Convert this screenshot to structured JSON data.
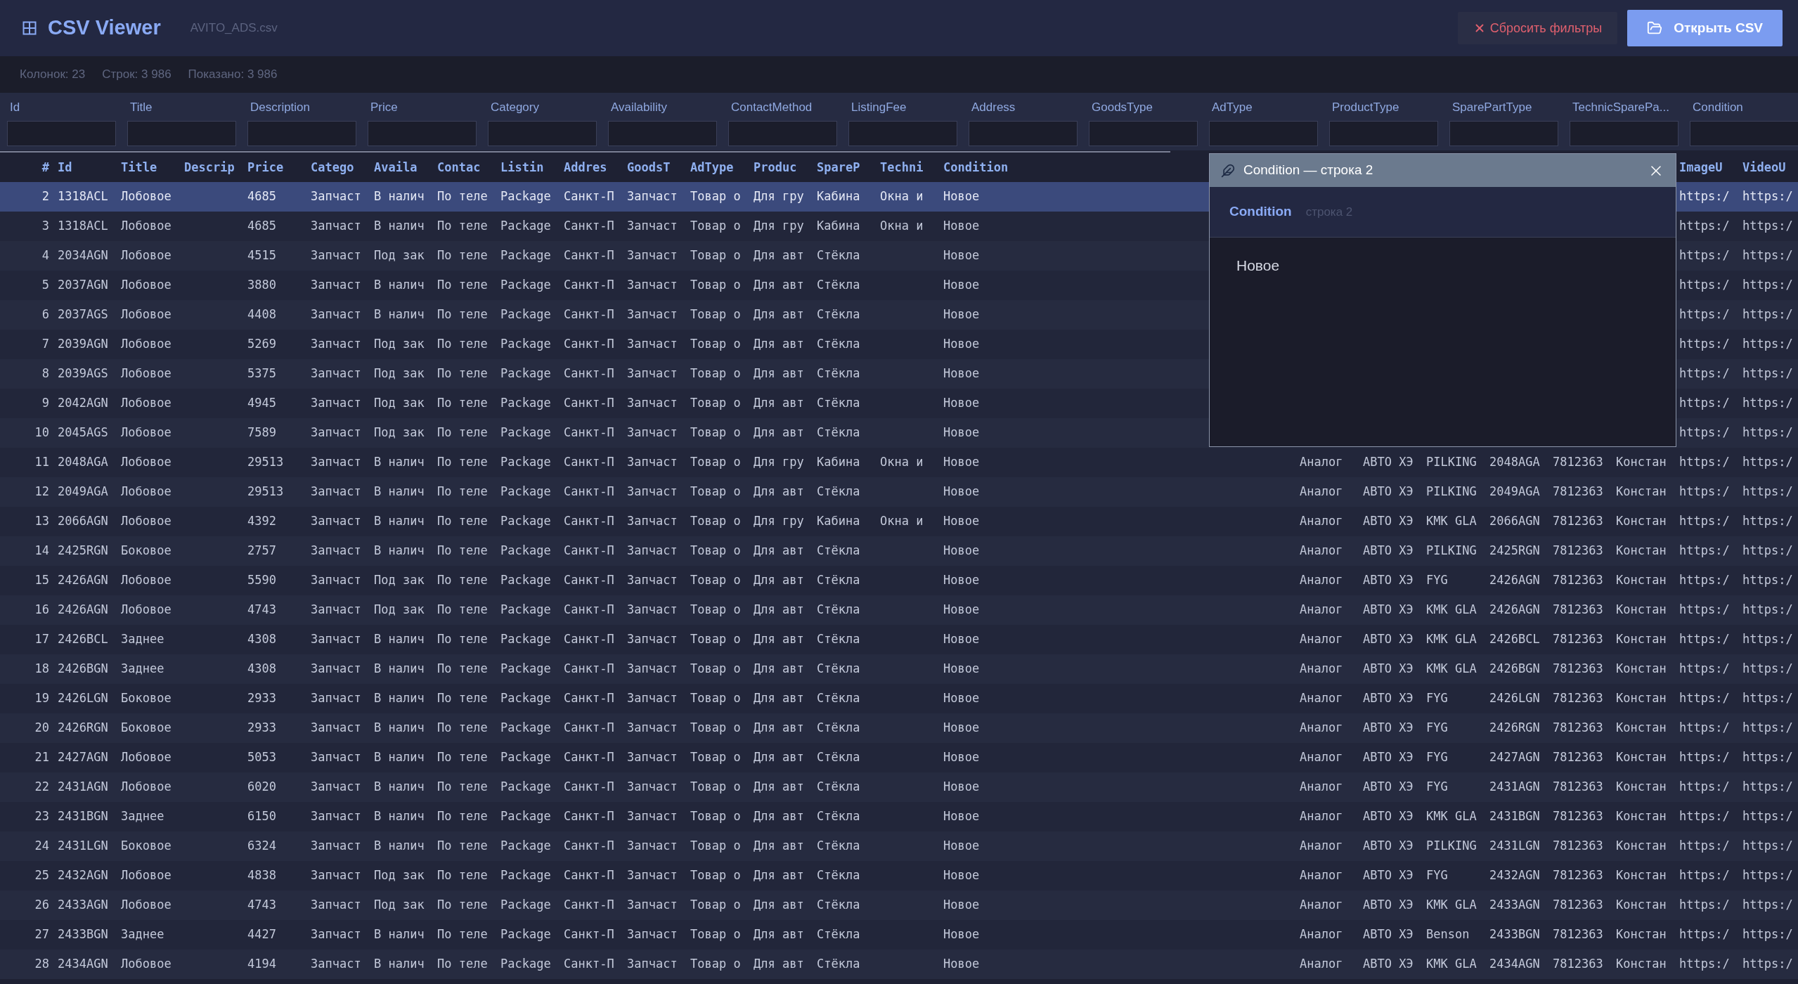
{
  "app": {
    "title": "CSV Viewer",
    "file_name": "AVITO_ADS.csv"
  },
  "buttons": {
    "reset": "Сбросить фильтры",
    "open": "Открыть CSV"
  },
  "stats": [
    "Колонок: 23",
    "Строк: 3 986",
    "Показано: 3 986"
  ],
  "filters": [
    {
      "label": "Id"
    },
    {
      "label": "Title"
    },
    {
      "label": "Description"
    },
    {
      "label": "Price"
    },
    {
      "label": "Category"
    },
    {
      "label": "Availability"
    },
    {
      "label": "ContactMethod"
    },
    {
      "label": "ListingFee"
    },
    {
      "label": "Address"
    },
    {
      "label": "GoodsType"
    },
    {
      "label": "AdType"
    },
    {
      "label": "ProductType"
    },
    {
      "label": "SparePartType"
    },
    {
      "label": "TechnicSparePa..."
    },
    {
      "label": "Condition"
    }
  ],
  "table": {
    "header": {
      "n": "#",
      "id": "Id",
      "title": "Title",
      "description": "Descrip",
      "price": "Price",
      "category": "Catego",
      "availability": "Availa",
      "contact": "Contac",
      "listing": "Listin",
      "address": "Addres",
      "goods_type": "GoodsT",
      "ad_type": "AdType",
      "product": "Produc",
      "spare_part": "SpareP",
      "technic": "Techni",
      "condition": "Condition",
      "image_url": "ImageU",
      "video_url": "VideoU"
    },
    "rows": [
      {
        "selected": true,
        "n": "2",
        "id": "1318ACL",
        "title": "Лобовое",
        "price": "4685",
        "category": "Запчаст",
        "availability": "В налич",
        "contact": "По теле",
        "listing": "Package",
        "address": "Санкт-П",
        "goods_type": "Запчаст",
        "ad_type": "Товар о",
        "product": "Для гру",
        "spare_part": "Кабина",
        "technic": "Окна и",
        "condition": "Новое",
        "image_url": "https:/",
        "video_url": "https:/"
      },
      {
        "selected": false,
        "n": "3",
        "id": "1318ACL",
        "title": "Лобовое",
        "price": "4685",
        "category": "Запчаст",
        "availability": "В налич",
        "contact": "По теле",
        "listing": "Package",
        "address": "Санкт-П",
        "goods_type": "Запчаст",
        "ad_type": "Товар о",
        "product": "Для гру",
        "spare_part": "Кабина",
        "technic": "Окна и",
        "condition": "Новое",
        "image_url": "https:/",
        "video_url": "https:/"
      },
      {
        "selected": false,
        "n": "4",
        "id": "2034AGN",
        "title": "Лобовое",
        "price": "4515",
        "category": "Запчаст",
        "availability": "Под зак",
        "contact": "По теле",
        "listing": "Package",
        "address": "Санкт-П",
        "goods_type": "Запчаст",
        "ad_type": "Товар о",
        "product": "Для авт",
        "spare_part": "Стёкла",
        "condition": "Новое",
        "image_url": "https:/",
        "video_url": "https:/"
      },
      {
        "selected": false,
        "n": "5",
        "id": "2037AGN",
        "title": "Лобовое",
        "price": "3880",
        "category": "Запчаст",
        "availability": "В налич",
        "contact": "По теле",
        "listing": "Package",
        "address": "Санкт-П",
        "goods_type": "Запчаст",
        "ad_type": "Товар о",
        "product": "Для авт",
        "spare_part": "Стёкла",
        "condition": "Новое",
        "image_url": "https:/",
        "video_url": "https:/"
      },
      {
        "selected": false,
        "n": "6",
        "id": "2037AGS",
        "title": "Лобовое",
        "price": "4408",
        "category": "Запчаст",
        "availability": "В налич",
        "contact": "По теле",
        "listing": "Package",
        "address": "Санкт-П",
        "goods_type": "Запчаст",
        "ad_type": "Товар о",
        "product": "Для авт",
        "spare_part": "Стёкла",
        "condition": "Новое",
        "image_url": "https:/",
        "video_url": "https:/"
      },
      {
        "selected": false,
        "n": "7",
        "id": "2039AGN",
        "title": "Лобовое",
        "price": "5269",
        "category": "Запчаст",
        "availability": "Под зак",
        "contact": "По теле",
        "listing": "Package",
        "address": "Санкт-П",
        "goods_type": "Запчаст",
        "ad_type": "Товар о",
        "product": "Для авт",
        "spare_part": "Стёкла",
        "condition": "Новое",
        "image_url": "https:/",
        "video_url": "https:/"
      },
      {
        "selected": false,
        "n": "8",
        "id": "2039AGS",
        "title": "Лобовое",
        "price": "5375",
        "category": "Запчаст",
        "availability": "Под зак",
        "contact": "По теле",
        "listing": "Package",
        "address": "Санкт-П",
        "goods_type": "Запчаст",
        "ad_type": "Товар о",
        "product": "Для авт",
        "spare_part": "Стёкла",
        "condition": "Новое",
        "image_url": "https:/",
        "video_url": "https:/"
      },
      {
        "selected": false,
        "n": "9",
        "id": "2042AGN",
        "title": "Лобовое",
        "price": "4945",
        "category": "Запчаст",
        "availability": "Под зак",
        "contact": "По теле",
        "listing": "Package",
        "address": "Санкт-П",
        "goods_type": "Запчаст",
        "ad_type": "Товар о",
        "product": "Для авт",
        "spare_part": "Стёкла",
        "condition": "Новое",
        "image_url": "https:/",
        "video_url": "https:/"
      },
      {
        "selected": false,
        "n": "10",
        "id": "2045AGS",
        "title": "Лобовое",
        "price": "7589",
        "category": "Запчаст",
        "availability": "Под зак",
        "contact": "По теле",
        "listing": "Package",
        "address": "Санкт-П",
        "goods_type": "Запчаст",
        "ad_type": "Товар о",
        "product": "Для авт",
        "spare_part": "Стёкла",
        "condition": "Новое",
        "image_url": "https:/",
        "video_url": "https:/"
      },
      {
        "selected": false,
        "n": "11",
        "id": "2048AGA",
        "title": "Лобовое",
        "price": "29513",
        "category": "Запчаст",
        "availability": "В налич",
        "contact": "По теле",
        "listing": "Package",
        "address": "Санкт-П",
        "goods_type": "Запчаст",
        "ad_type": "Товар о",
        "product": "Для гру",
        "spare_part": "Кабина",
        "technic": "Окна и",
        "condition": "Новое",
        "column_17": "Аналог",
        "column_18": "АВТО ХЭ",
        "column_19": "PILKING",
        "column_20": "2048AGA",
        "column_21": "7812363",
        "column_22": "Констан",
        "image_url": "https:/",
        "video_url": "https:/"
      },
      {
        "selected": false,
        "n": "12",
        "id": "2049AGA",
        "title": "Лобовое",
        "price": "29513",
        "category": "Запчаст",
        "availability": "В налич",
        "contact": "По теле",
        "listing": "Package",
        "address": "Санкт-П",
        "goods_type": "Запчаст",
        "ad_type": "Товар о",
        "product": "Для авт",
        "spare_part": "Стёкла",
        "condition": "Новое",
        "column_17": "Аналог",
        "column_18": "АВТО ХЭ",
        "column_19": "PILKING",
        "column_20": "2049AGA",
        "column_21": "7812363",
        "column_22": "Констан",
        "image_url": "https:/",
        "video_url": "https:/"
      },
      {
        "selected": false,
        "n": "13",
        "id": "2066AGN",
        "title": "Лобовое",
        "price": "4392",
        "category": "Запчаст",
        "availability": "В налич",
        "contact": "По теле",
        "listing": "Package",
        "address": "Санкт-П",
        "goods_type": "Запчаст",
        "ad_type": "Товар о",
        "product": "Для гру",
        "spare_part": "Кабина",
        "technic": "Окна и",
        "condition": "Новое",
        "column_17": "Аналог",
        "column_18": "АВТО ХЭ",
        "column_19": "KMK GLA",
        "column_20": "2066AGN",
        "column_21": "7812363",
        "column_22": "Констан",
        "image_url": "https:/",
        "video_url": "https:/"
      },
      {
        "selected": false,
        "n": "14",
        "id": "2425RGN",
        "title": "Боковое",
        "price": "2757",
        "category": "Запчаст",
        "availability": "В налич",
        "contact": "По теле",
        "listing": "Package",
        "address": "Санкт-П",
        "goods_type": "Запчаст",
        "ad_type": "Товар о",
        "product": "Для авт",
        "spare_part": "Стёкла",
        "condition": "Новое",
        "column_17": "Аналог",
        "column_18": "АВТО ХЭ",
        "column_19": "PILKING",
        "column_20": "2425RGN",
        "column_21": "7812363",
        "column_22": "Констан",
        "image_url": "https:/",
        "video_url": "https:/"
      },
      {
        "selected": false,
        "n": "15",
        "id": "2426AGN",
        "title": "Лобовое",
        "price": "5590",
        "category": "Запчаст",
        "availability": "Под зак",
        "contact": "По теле",
        "listing": "Package",
        "address": "Санкт-П",
        "goods_type": "Запчаст",
        "ad_type": "Товар о",
        "product": "Для авт",
        "spare_part": "Стёкла",
        "condition": "Новое",
        "column_17": "Аналог",
        "column_18": "АВТО ХЭ",
        "column_19": "FYG",
        "column_20": "2426AGN",
        "column_21": "7812363",
        "column_22": "Констан",
        "image_url": "https:/",
        "video_url": "https:/"
      },
      {
        "selected": false,
        "n": "16",
        "id": "2426AGN",
        "title": "Лобовое",
        "price": "4743",
        "category": "Запчаст",
        "availability": "Под зак",
        "contact": "По теле",
        "listing": "Package",
        "address": "Санкт-П",
        "goods_type": "Запчаст",
        "ad_type": "Товар о",
        "product": "Для авт",
        "spare_part": "Стёкла",
        "condition": "Новое",
        "column_17": "Аналог",
        "column_18": "АВТО ХЭ",
        "column_19": "KMK GLA",
        "column_20": "2426AGN",
        "column_21": "7812363",
        "column_22": "Констан",
        "image_url": "https:/",
        "video_url": "https:/"
      },
      {
        "selected": false,
        "n": "17",
        "id": "2426BCL",
        "title": "Заднее",
        "price": "4308",
        "category": "Запчаст",
        "availability": "В налич",
        "contact": "По теле",
        "listing": "Package",
        "address": "Санкт-П",
        "goods_type": "Запчаст",
        "ad_type": "Товар о",
        "product": "Для авт",
        "spare_part": "Стёкла",
        "condition": "Новое",
        "column_17": "Аналог",
        "column_18": "АВТО ХЭ",
        "column_19": "KMK GLA",
        "column_20": "2426BCL",
        "column_21": "7812363",
        "column_22": "Констан",
        "image_url": "https:/",
        "video_url": "https:/"
      },
      {
        "selected": false,
        "n": "18",
        "id": "2426BGN",
        "title": "Заднее",
        "price": "4308",
        "category": "Запчаст",
        "availability": "В налич",
        "contact": "По теле",
        "listing": "Package",
        "address": "Санкт-П",
        "goods_type": "Запчаст",
        "ad_type": "Товар о",
        "product": "Для авт",
        "spare_part": "Стёкла",
        "condition": "Новое",
        "column_17": "Аналог",
        "column_18": "АВТО ХЭ",
        "column_19": "KMK GLA",
        "column_20": "2426BGN",
        "column_21": "7812363",
        "column_22": "Констан",
        "image_url": "https:/",
        "video_url": "https:/"
      },
      {
        "selected": false,
        "n": "19",
        "id": "2426LGN",
        "title": "Боковое",
        "price": "2933",
        "category": "Запчаст",
        "availability": "В налич",
        "contact": "По теле",
        "listing": "Package",
        "address": "Санкт-П",
        "goods_type": "Запчаст",
        "ad_type": "Товар о",
        "product": "Для авт",
        "spare_part": "Стёкла",
        "condition": "Новое",
        "column_17": "Аналог",
        "column_18": "АВТО ХЭ",
        "column_19": "FYG",
        "column_20": "2426LGN",
        "column_21": "7812363",
        "column_22": "Констан",
        "image_url": "https:/",
        "video_url": "https:/"
      },
      {
        "selected": false,
        "n": "20",
        "id": "2426RGN",
        "title": "Боковое",
        "price": "2933",
        "category": "Запчаст",
        "availability": "В налич",
        "contact": "По теле",
        "listing": "Package",
        "address": "Санкт-П",
        "goods_type": "Запчаст",
        "ad_type": "Товар о",
        "product": "Для авт",
        "spare_part": "Стёкла",
        "condition": "Новое",
        "column_17": "Аналог",
        "column_18": "АВТО ХЭ",
        "column_19": "FYG",
        "column_20": "2426RGN",
        "column_21": "7812363",
        "column_22": "Констан",
        "image_url": "https:/",
        "video_url": "https:/"
      },
      {
        "selected": false,
        "n": "21",
        "id": "2427AGN",
        "title": "Лобовое",
        "price": "5053",
        "category": "Запчаст",
        "availability": "В налич",
        "contact": "По теле",
        "listing": "Package",
        "address": "Санкт-П",
        "goods_type": "Запчаст",
        "ad_type": "Товар о",
        "product": "Для авт",
        "spare_part": "Стёкла",
        "condition": "Новое",
        "column_17": "Аналог",
        "column_18": "АВТО ХЭ",
        "column_19": "FYG",
        "column_20": "2427AGN",
        "column_21": "7812363",
        "column_22": "Констан",
        "image_url": "https:/",
        "video_url": "https:/"
      },
      {
        "selected": false,
        "n": "22",
        "id": "2431AGN",
        "title": "Лобовое",
        "price": "6020",
        "category": "Запчаст",
        "availability": "В налич",
        "contact": "По теле",
        "listing": "Package",
        "address": "Санкт-П",
        "goods_type": "Запчаст",
        "ad_type": "Товар о",
        "product": "Для авт",
        "spare_part": "Стёкла",
        "condition": "Новое",
        "column_17": "Аналог",
        "column_18": "АВТО ХЭ",
        "column_19": "FYG",
        "column_20": "2431AGN",
        "column_21": "7812363",
        "column_22": "Констан",
        "image_url": "https:/",
        "video_url": "https:/"
      },
      {
        "selected": false,
        "n": "23",
        "id": "2431BGN",
        "title": "Заднее",
        "price": "6150",
        "category": "Запчаст",
        "availability": "В налич",
        "contact": "По теле",
        "listing": "Package",
        "address": "Санкт-П",
        "goods_type": "Запчаст",
        "ad_type": "Товар о",
        "product": "Для авт",
        "spare_part": "Стёкла",
        "condition": "Новое",
        "column_17": "Аналог",
        "column_18": "АВТО ХЭ",
        "column_19": "KMK GLA",
        "column_20": "2431BGN",
        "column_21": "7812363",
        "column_22": "Констан",
        "image_url": "https:/",
        "video_url": "https:/"
      },
      {
        "selected": false,
        "n": "24",
        "id": "2431LGN",
        "title": "Боковое",
        "price": "6324",
        "category": "Запчаст",
        "availability": "В налич",
        "contact": "По теле",
        "listing": "Package",
        "address": "Санкт-П",
        "goods_type": "Запчаст",
        "ad_type": "Товар о",
        "product": "Для авт",
        "spare_part": "Стёкла",
        "condition": "Новое",
        "column_17": "Аналог",
        "column_18": "АВТО ХЭ",
        "column_19": "PILKING",
        "column_20": "2431LGN",
        "column_21": "7812363",
        "column_22": "Констан",
        "image_url": "https:/",
        "video_url": "https:/"
      },
      {
        "selected": false,
        "n": "25",
        "id": "2432AGN",
        "title": "Лобовое",
        "price": "4838",
        "category": "Запчаст",
        "availability": "Под зак",
        "contact": "По теле",
        "listing": "Package",
        "address": "Санкт-П",
        "goods_type": "Запчаст",
        "ad_type": "Товар о",
        "product": "Для авт",
        "spare_part": "Стёкла",
        "condition": "Новое",
        "column_17": "Аналог",
        "column_18": "АВТО ХЭ",
        "column_19": "FYG",
        "column_20": "2432AGN",
        "column_21": "7812363",
        "column_22": "Констан",
        "image_url": "https:/",
        "video_url": "https:/"
      },
      {
        "selected": false,
        "n": "26",
        "id": "2433AGN",
        "title": "Лобовое",
        "price": "4743",
        "category": "Запчаст",
        "availability": "Под зак",
        "contact": "По теле",
        "listing": "Package",
        "address": "Санкт-П",
        "goods_type": "Запчаст",
        "ad_type": "Товар о",
        "product": "Для авт",
        "spare_part": "Стёкла",
        "condition": "Новое",
        "column_17": "Аналог",
        "column_18": "АВТО ХЭ",
        "column_19": "KMK GLA",
        "column_20": "2433AGN",
        "column_21": "7812363",
        "column_22": "Констан",
        "image_url": "https:/",
        "video_url": "https:/"
      },
      {
        "selected": false,
        "n": "27",
        "id": "2433BGN",
        "title": "Заднее",
        "price": "4427",
        "category": "Запчаст",
        "availability": "В налич",
        "contact": "По теле",
        "listing": "Package",
        "address": "Санкт-П",
        "goods_type": "Запчаст",
        "ad_type": "Товар о",
        "product": "Для авт",
        "spare_part": "Стёкла",
        "condition": "Новое",
        "column_17": "Аналог",
        "column_18": "АВТО ХЭ",
        "column_19": "Benson",
        "column_20": "2433BGN",
        "column_21": "7812363",
        "column_22": "Констан",
        "image_url": "https:/",
        "video_url": "https:/"
      },
      {
        "selected": false,
        "n": "28",
        "id": "2434AGN",
        "title": "Лобовое",
        "price": "4194",
        "category": "Запчаст",
        "availability": "В налич",
        "contact": "По теле",
        "listing": "Package",
        "address": "Санкт-П",
        "goods_type": "Запчаст",
        "ad_type": "Товар о",
        "product": "Для авт",
        "spare_part": "Стёкла",
        "condition": "Новое",
        "column_17": "Аналог",
        "column_18": "АВТО ХЭ",
        "column_19": "KMK GLA",
        "column_20": "2434AGN",
        "column_21": "7812363",
        "column_22": "Констан",
        "image_url": "https:/",
        "video_url": "https:/"
      }
    ]
  },
  "dialog": {
    "title": "Condition — строка 2",
    "field": "Condition",
    "row": "строка 2",
    "value": "Новое"
  }
}
